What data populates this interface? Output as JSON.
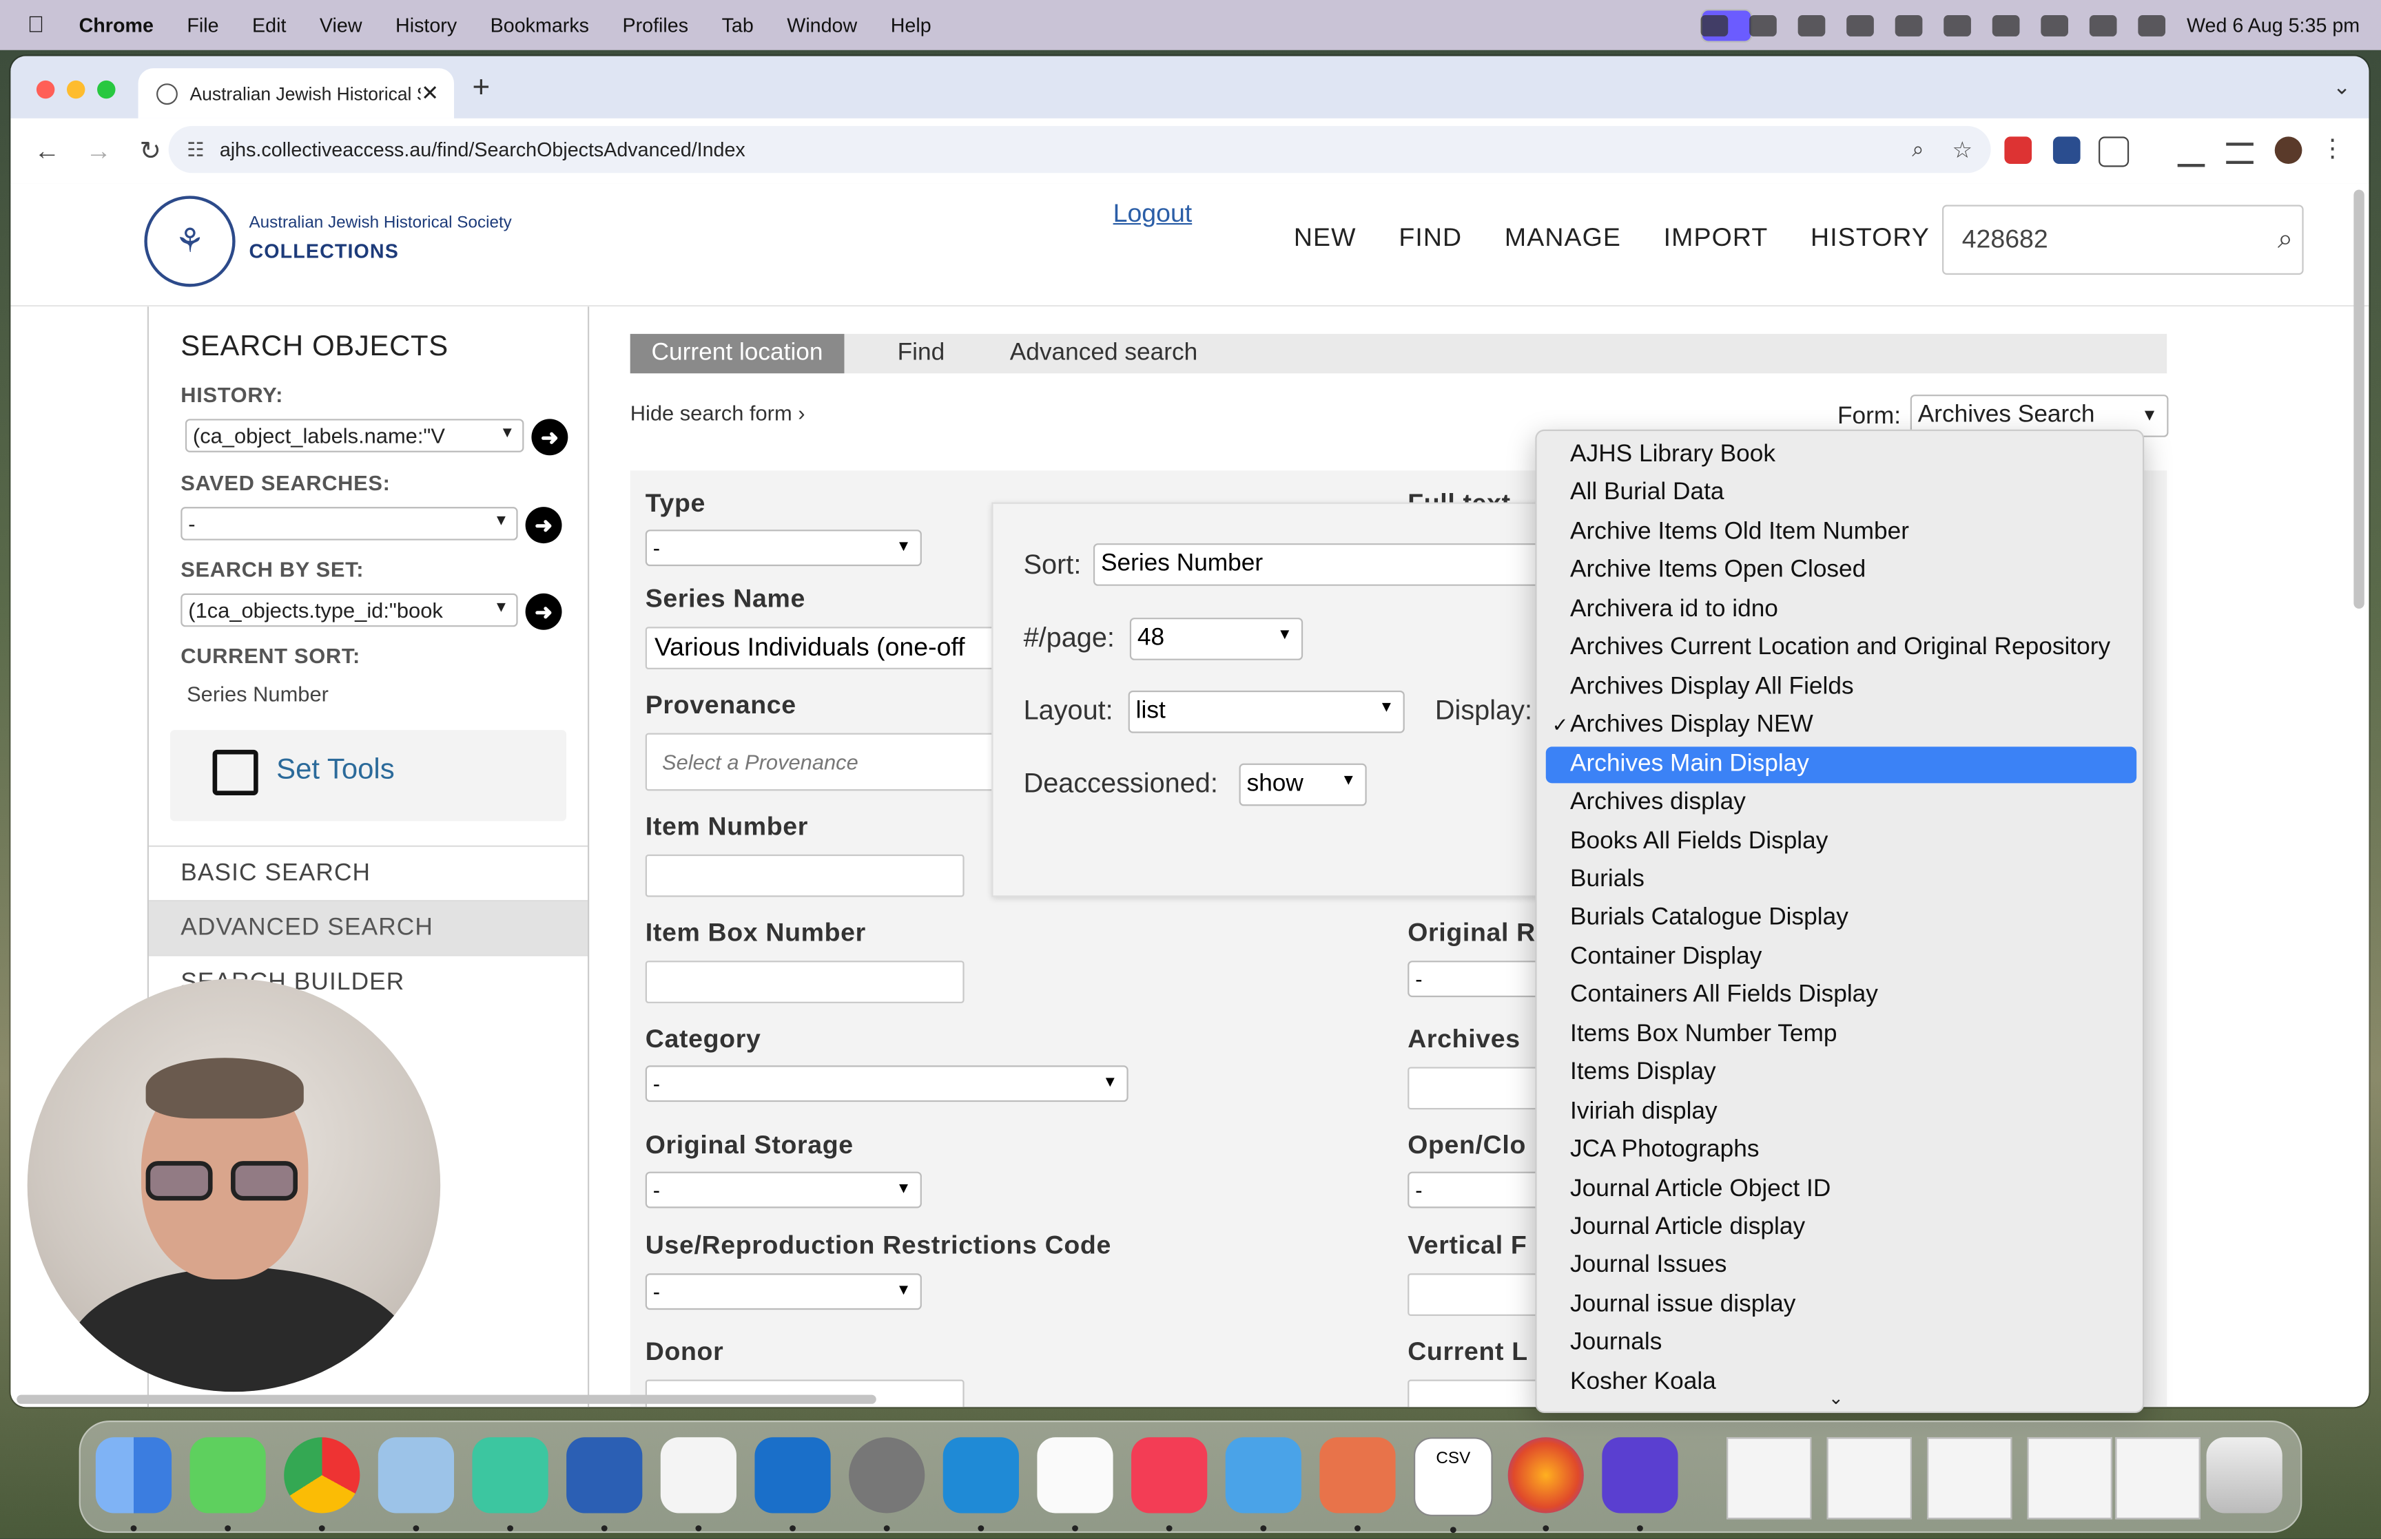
{
  "menubar": {
    "app": "Chrome",
    "items": [
      "File",
      "Edit",
      "View",
      "History",
      "Bookmarks",
      "Profiles",
      "Tab",
      "Window",
      "Help"
    ],
    "clock": "Wed 6 Aug  5:35 pm"
  },
  "browser": {
    "tab_title": "Australian Jewish Historical S",
    "url": "ajhs.collectiveaccess.au/find/SearchObjectsAdvanced/Index"
  },
  "site": {
    "logo_line1": "Australian Jewish Historical Society",
    "logo_line2": "COLLECTIONS",
    "logout": "Logout",
    "nav": [
      "NEW",
      "FIND",
      "MANAGE",
      "IMPORT",
      "HISTORY"
    ],
    "quick_search_value": "428682"
  },
  "sidebar": {
    "heading": "SEARCH OBJECTS",
    "history_label": "HISTORY:",
    "history_value": "(ca_object_labels.name:\"V",
    "saved_label": "SAVED SEARCHES:",
    "saved_value": "-",
    "set_label": "SEARCH BY SET:",
    "set_value": "(1ca_objects.type_id:\"book",
    "sort_label": "CURRENT SORT:",
    "sort_value": "Series Number",
    "set_tools": "Set Tools",
    "nav": [
      "BASIC SEARCH",
      "ADVANCED SEARCH",
      "SEARCH BUILDER"
    ]
  },
  "main": {
    "breadcrumb": [
      "Current location",
      "Find",
      "Advanced search"
    ],
    "hide_form": "Hide search form ›",
    "form_label": "Form:",
    "form_value": "Archives Search",
    "fields": {
      "type": "Type",
      "type_value": "-",
      "full_text": "Full text",
      "series_name": "Series Name",
      "series_value": "Various Individuals (one-off",
      "provenance": "Provenance",
      "provenance_placeholder": "Select a Provenance",
      "item_number": "Item Number",
      "item_box_number": "Item Box Number",
      "original_r": "Original R",
      "original_r_value": "-",
      "category": "Category",
      "category_value": "-",
      "archives": "Archives",
      "original_storage": "Original Storage",
      "original_storage_value": "-",
      "open_clo": "Open/Clo",
      "open_clo_value": "-",
      "use_repro": "Use/Reproduction Restrictions Code",
      "use_repro_value": "-",
      "vertical_f": "Vertical F",
      "donor": "Donor",
      "current_l": "Current L"
    },
    "popup": {
      "sort_label": "Sort:",
      "sort_value": "Series Number",
      "perpage_label": "#/page:",
      "perpage_value": "48",
      "layout_label": "Layout:",
      "layout_value": "list",
      "display_label": "Display:",
      "deacc_label": "Deaccessioned:",
      "deacc_value": "show"
    }
  },
  "display_dropdown": {
    "selected": "Archives Display NEW",
    "highlighted": "Archives Main Display",
    "options": [
      "AJHS Library Book",
      "All Burial Data",
      "Archive Items Old Item Number",
      "Archive Items Open Closed",
      "Archivera id to idno",
      "Archives Current Location and Original Repository",
      "Archives Display All Fields",
      "Archives Display NEW",
      "Archives Main Display",
      "Archives display",
      "Books All Fields Display",
      "Burials",
      "Burials Catalogue Display",
      "Container Display",
      "Containers All Fields Display",
      "Items Box Number Temp",
      "Items Display",
      "Iviriah display",
      "JCA Photographs",
      "Journal Article Object ID",
      "Journal Article display",
      "Journal Issues",
      "Journal issue display",
      "Journals",
      "Kosher Koala"
    ]
  },
  "dock": {
    "csv_label": "CSV"
  }
}
